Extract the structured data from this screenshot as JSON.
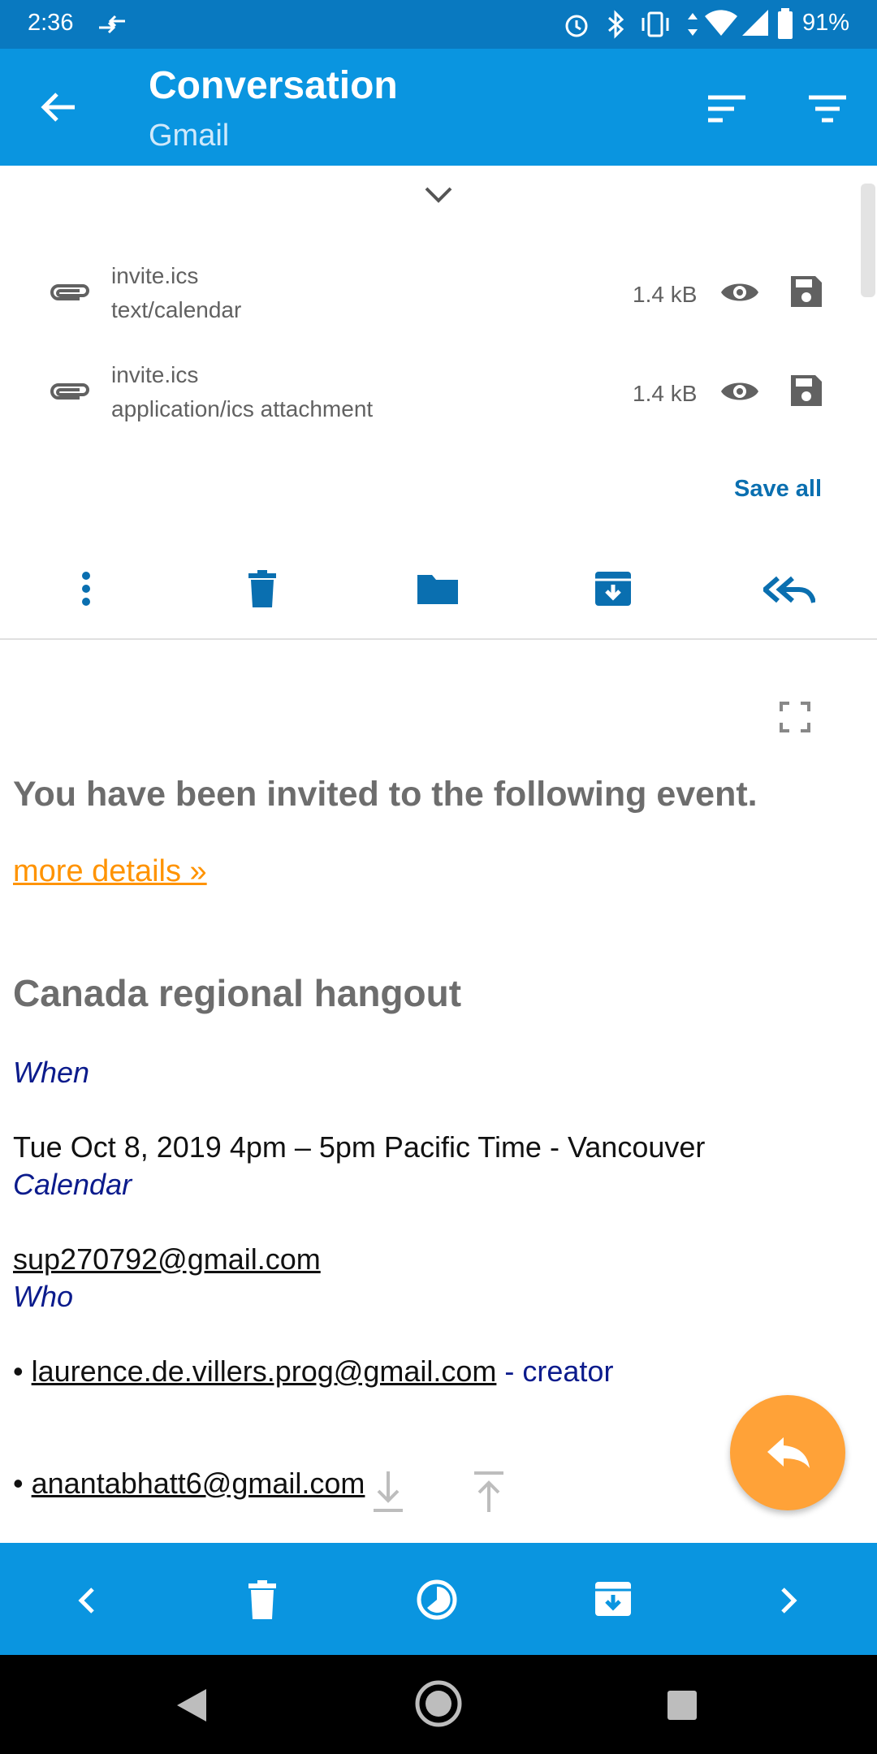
{
  "status_bar": {
    "time": "2:36",
    "battery": "91%"
  },
  "app_bar": {
    "title": "Conversation",
    "subtitle": "Gmail"
  },
  "attachments": [
    {
      "name": "invite.ics",
      "type": "text/calendar",
      "size": "1.4 kB"
    },
    {
      "name": "invite.ics",
      "type": "application/ics attachment",
      "size": "1.4 kB"
    }
  ],
  "save_all_label": "Save all",
  "message": {
    "heading": "You have been invited to the following event.",
    "more_details": "more details »",
    "event_title": "Canada regional hangout",
    "when_label": "When",
    "when_value": "Tue Oct 8, 2019 4pm – 5pm Pacific Time - Vancouver",
    "calendar_label": "Calendar",
    "calendar_value": "sup270792@gmail.com",
    "who_label": "Who",
    "attendees": [
      {
        "email": "laurence.de.villers.prog@gmail.com",
        "role": " - creator"
      },
      {
        "email": "anantabhatt6@gmail.com",
        "role": ""
      }
    ]
  },
  "colors": {
    "status_bar": "#0979c0",
    "app_bar": "#0a95e0",
    "accent": "#ff9300",
    "fab": "#ffa238",
    "icon_blue": "#0a6fb0"
  },
  "icons": {
    "app_bar": [
      "back-arrow-icon",
      "sort-icon",
      "filter-icon"
    ],
    "attachment_row": [
      "paperclip-icon",
      "eye-icon",
      "save-icon"
    ],
    "message_actions": [
      "more-vert-icon",
      "delete-icon",
      "folder-icon",
      "archive-icon",
      "reply-all-icon"
    ],
    "bottom_bar": [
      "previous-icon",
      "delete-icon",
      "snooze-icon",
      "archive-icon",
      "next-icon"
    ]
  }
}
